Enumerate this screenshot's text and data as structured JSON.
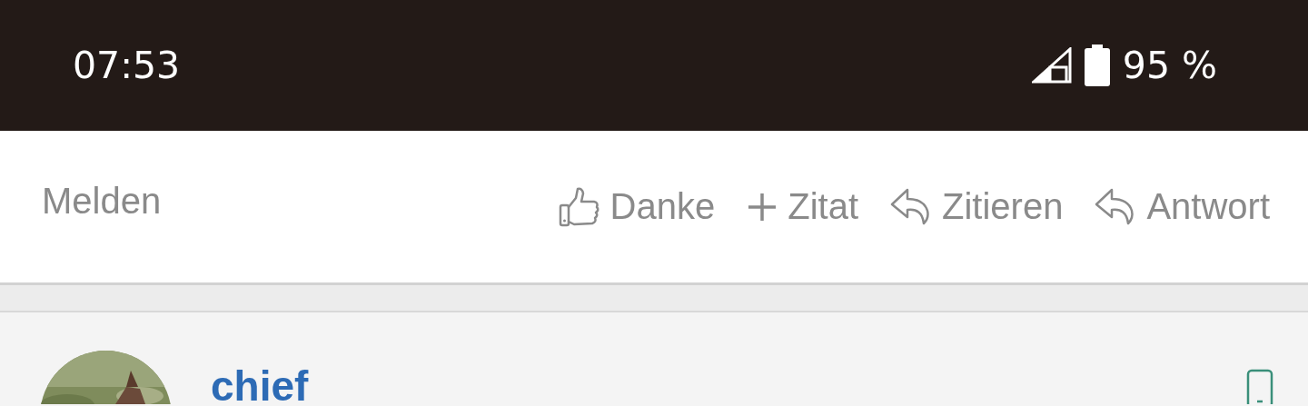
{
  "status_bar": {
    "time": "07:53",
    "battery": "95 %"
  },
  "post_actions": {
    "report": "Melden",
    "actions": [
      {
        "kind": "like",
        "label": "Danke"
      },
      {
        "kind": "add",
        "label": "Zitat"
      },
      {
        "kind": "reply",
        "label": "Zitieren"
      },
      {
        "kind": "reply",
        "label": "Antwort"
      }
    ]
  },
  "post": {
    "username": "chief"
  }
}
